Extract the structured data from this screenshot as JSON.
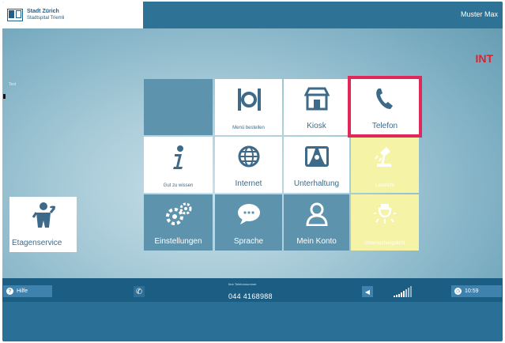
{
  "header": {
    "logo_line1": "Stadt Zürich",
    "logo_line2": "Stadtspital Triemli",
    "user_name": "Muster Max"
  },
  "badge": "INT",
  "side_label": "Test",
  "tiles": {
    "menu": {
      "label": "Menü bestellen",
      "icon": "cutlery-icon"
    },
    "kiosk": {
      "label": "Kiosk",
      "icon": "shop-icon"
    },
    "telefon": {
      "label": "Telefon",
      "icon": "phone-icon"
    },
    "info": {
      "label": "Gut zu wissen",
      "icon": "info-icon"
    },
    "internet": {
      "label": "Internet",
      "icon": "globe-icon"
    },
    "unterhaltung": {
      "label": "Unterhaltung",
      "icon": "theater-icon"
    },
    "leselicht": {
      "label": "Leselicht",
      "icon": "reading-lamp-icon"
    },
    "einstellungen": {
      "label": "Einstellungen",
      "icon": "gears-icon"
    },
    "sprache": {
      "label": "Sprache",
      "icon": "speech-bubble-icon"
    },
    "konto": {
      "label": "Mein Konto",
      "icon": "user-icon"
    },
    "untersuchungslicht": {
      "label": "Untersuchungslicht",
      "icon": "light-bulb-icon"
    },
    "etagenservice": {
      "label": "Etagenservice",
      "icon": "waiter-icon"
    }
  },
  "footer": {
    "help_label": "Hilfe",
    "number_caption": "Ihre Telefonnummer",
    "phone_number": "044 4168988",
    "time": "10:59"
  },
  "colors": {
    "accent_blue": "#2e7396",
    "tile_blue": "#5e93ae",
    "tile_yellow": "#f4f3a6",
    "highlight": "#e0285a",
    "int_red": "#e0202f"
  }
}
